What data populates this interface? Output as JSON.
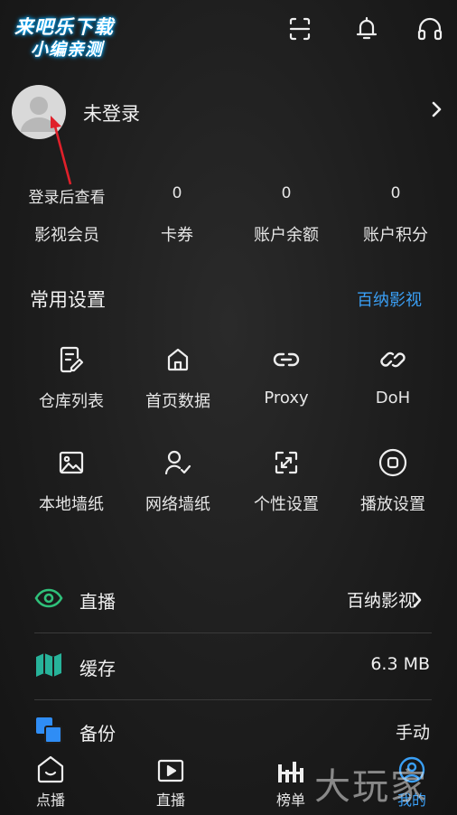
{
  "watermark": {
    "line1": "来吧乐下载",
    "line2": "小编亲测"
  },
  "profile": {
    "name": "未登录"
  },
  "stats": [
    {
      "value": "登录后查看",
      "label": "影视会员"
    },
    {
      "value": "0",
      "label": "卡券"
    },
    {
      "value": "0",
      "label": "账户余额"
    },
    {
      "value": "0",
      "label": "账户积分"
    }
  ],
  "common_settings": {
    "title": "常用设置",
    "link": "百纳影视",
    "items": [
      {
        "label": "仓库列表",
        "icon": "edit-doc-icon"
      },
      {
        "label": "首页数据",
        "icon": "home-icon"
      },
      {
        "label": "Proxy",
        "icon": "link-icon"
      },
      {
        "label": "DoH",
        "icon": "double-link-icon"
      },
      {
        "label": "本地墙纸",
        "icon": "image-icon"
      },
      {
        "label": "网络墙纸",
        "icon": "user-check-icon"
      },
      {
        "label": "个性设置",
        "icon": "expand-icon"
      },
      {
        "label": "播放设置",
        "icon": "stop-circle-icon"
      }
    ]
  },
  "rows": [
    {
      "label": "直播",
      "value": "百纳影视",
      "icon": "eye-icon",
      "color": "#2fc07a"
    },
    {
      "label": "缓存",
      "value": "6.3 MB",
      "icon": "map-icon",
      "color": "#27b39a"
    },
    {
      "label": "备份",
      "value": "手动",
      "icon": "copy-icon",
      "color": "#2f8df5"
    }
  ],
  "nav": [
    {
      "label": "点播",
      "icon": "home-smile-icon"
    },
    {
      "label": "直播",
      "icon": "play-box-icon"
    },
    {
      "label": "榜单",
      "icon": "chart-icon"
    },
    {
      "label": "我的",
      "icon": "user-circle-icon"
    }
  ],
  "watermark_bottom": "大玩家",
  "colors": {
    "accent": "#3a9ff5",
    "background": "#1e1e1e"
  }
}
